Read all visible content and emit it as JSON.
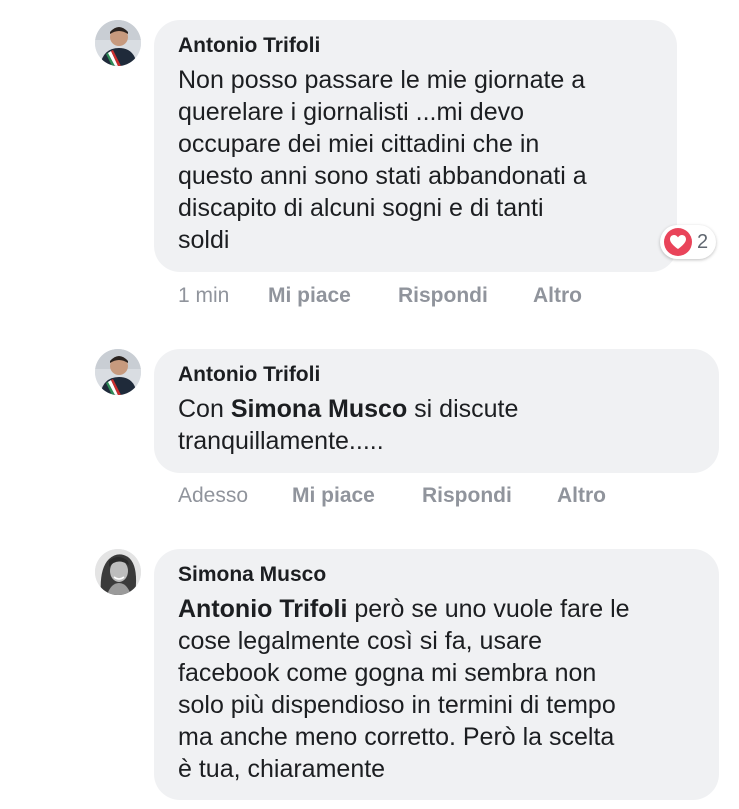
{
  "comments": [
    {
      "author": "Antonio Trifoli",
      "lines": [
        "Non posso passare le mie giornate a",
        "querelare i giornalisti ...mi devo",
        "occupare dei miei cittadini che in",
        "questo anni sono stati abbandonati a",
        "discapito di alcuni sogni e di tanti",
        "soldi"
      ],
      "reaction": {
        "icon": "heart-icon",
        "count": "2",
        "color": "#e9445a"
      },
      "time": "1 min",
      "like_label": "Mi piace",
      "reply_label": "Rispondi",
      "more_label": "Altro"
    },
    {
      "author": "Antonio Trifoli",
      "line1_prefix": "Con ",
      "line1_mention": "Simona Musco",
      "line1_suffix": " si discute",
      "line2": "tranquillamente.....",
      "time": "Adesso",
      "like_label": "Mi piace",
      "reply_label": "Rispondi",
      "more_label": "Altro"
    },
    {
      "author": "Simona Musco",
      "line1_mention": "Antonio Trifoli",
      "line1_suffix": " però se uno vuole fare le",
      "lines_rest": [
        "cose legalmente così si fa, usare",
        "facebook come gogna mi sembra non",
        "solo più dispendioso in termini di tempo",
        "ma anche meno corretto. Però la scelta",
        "è tua, chiaramente"
      ]
    }
  ],
  "colors": {
    "bubble": "#f0f1f3",
    "meta_text": "#90949c",
    "heart": "#e9445a"
  }
}
